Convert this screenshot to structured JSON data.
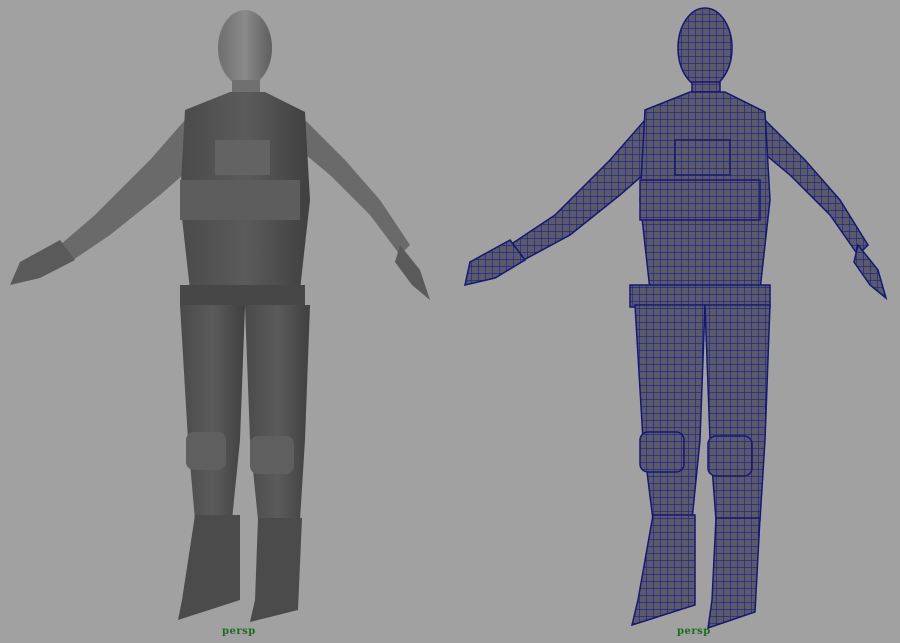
{
  "viewport": {
    "background": "#a1a1a1",
    "wire_color": "#1a1f8c",
    "panels": [
      {
        "shading": "smooth-shaded",
        "camera": "persp"
      },
      {
        "shading": "wireframe-on-shaded",
        "camera": "persp"
      }
    ],
    "label_color": "#1e6b1e"
  }
}
